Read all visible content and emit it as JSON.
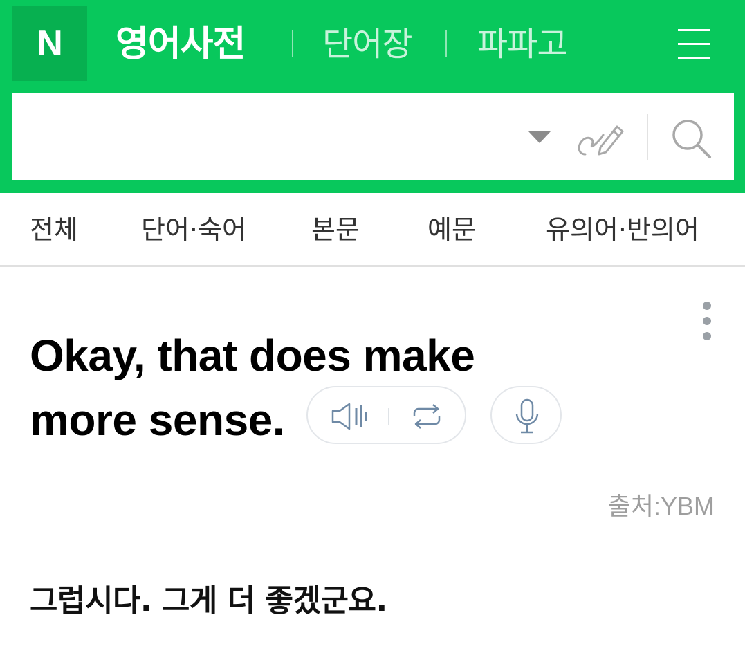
{
  "header": {
    "logo_text": "N",
    "title": "영어사전",
    "links": [
      "단어장",
      "파파고"
    ],
    "menu_icon": "hamburger-menu-icon",
    "colors": {
      "brand_green": "#08c85c",
      "logo_bg": "#07b050"
    }
  },
  "search": {
    "value": "",
    "dropdown_icon": "caret-down-icon",
    "handwriting_icon": "handwriting-pen-icon",
    "search_icon": "magnifier-icon"
  },
  "tabs": [
    "전체",
    "단어·숙어",
    "본문",
    "예문",
    "유의어·반의어"
  ],
  "entry": {
    "sentence_lines": [
      "Okay, that does make",
      "more sense."
    ],
    "audio_controls": {
      "play_icon": "speaker-icon",
      "repeat_icon": "repeat-icon"
    },
    "mic_icon": "microphone-icon",
    "more_icon": "more-vertical-icon",
    "source": "출처:YBM",
    "translation": "그럽시다. 그게 더 좋겠군요."
  }
}
